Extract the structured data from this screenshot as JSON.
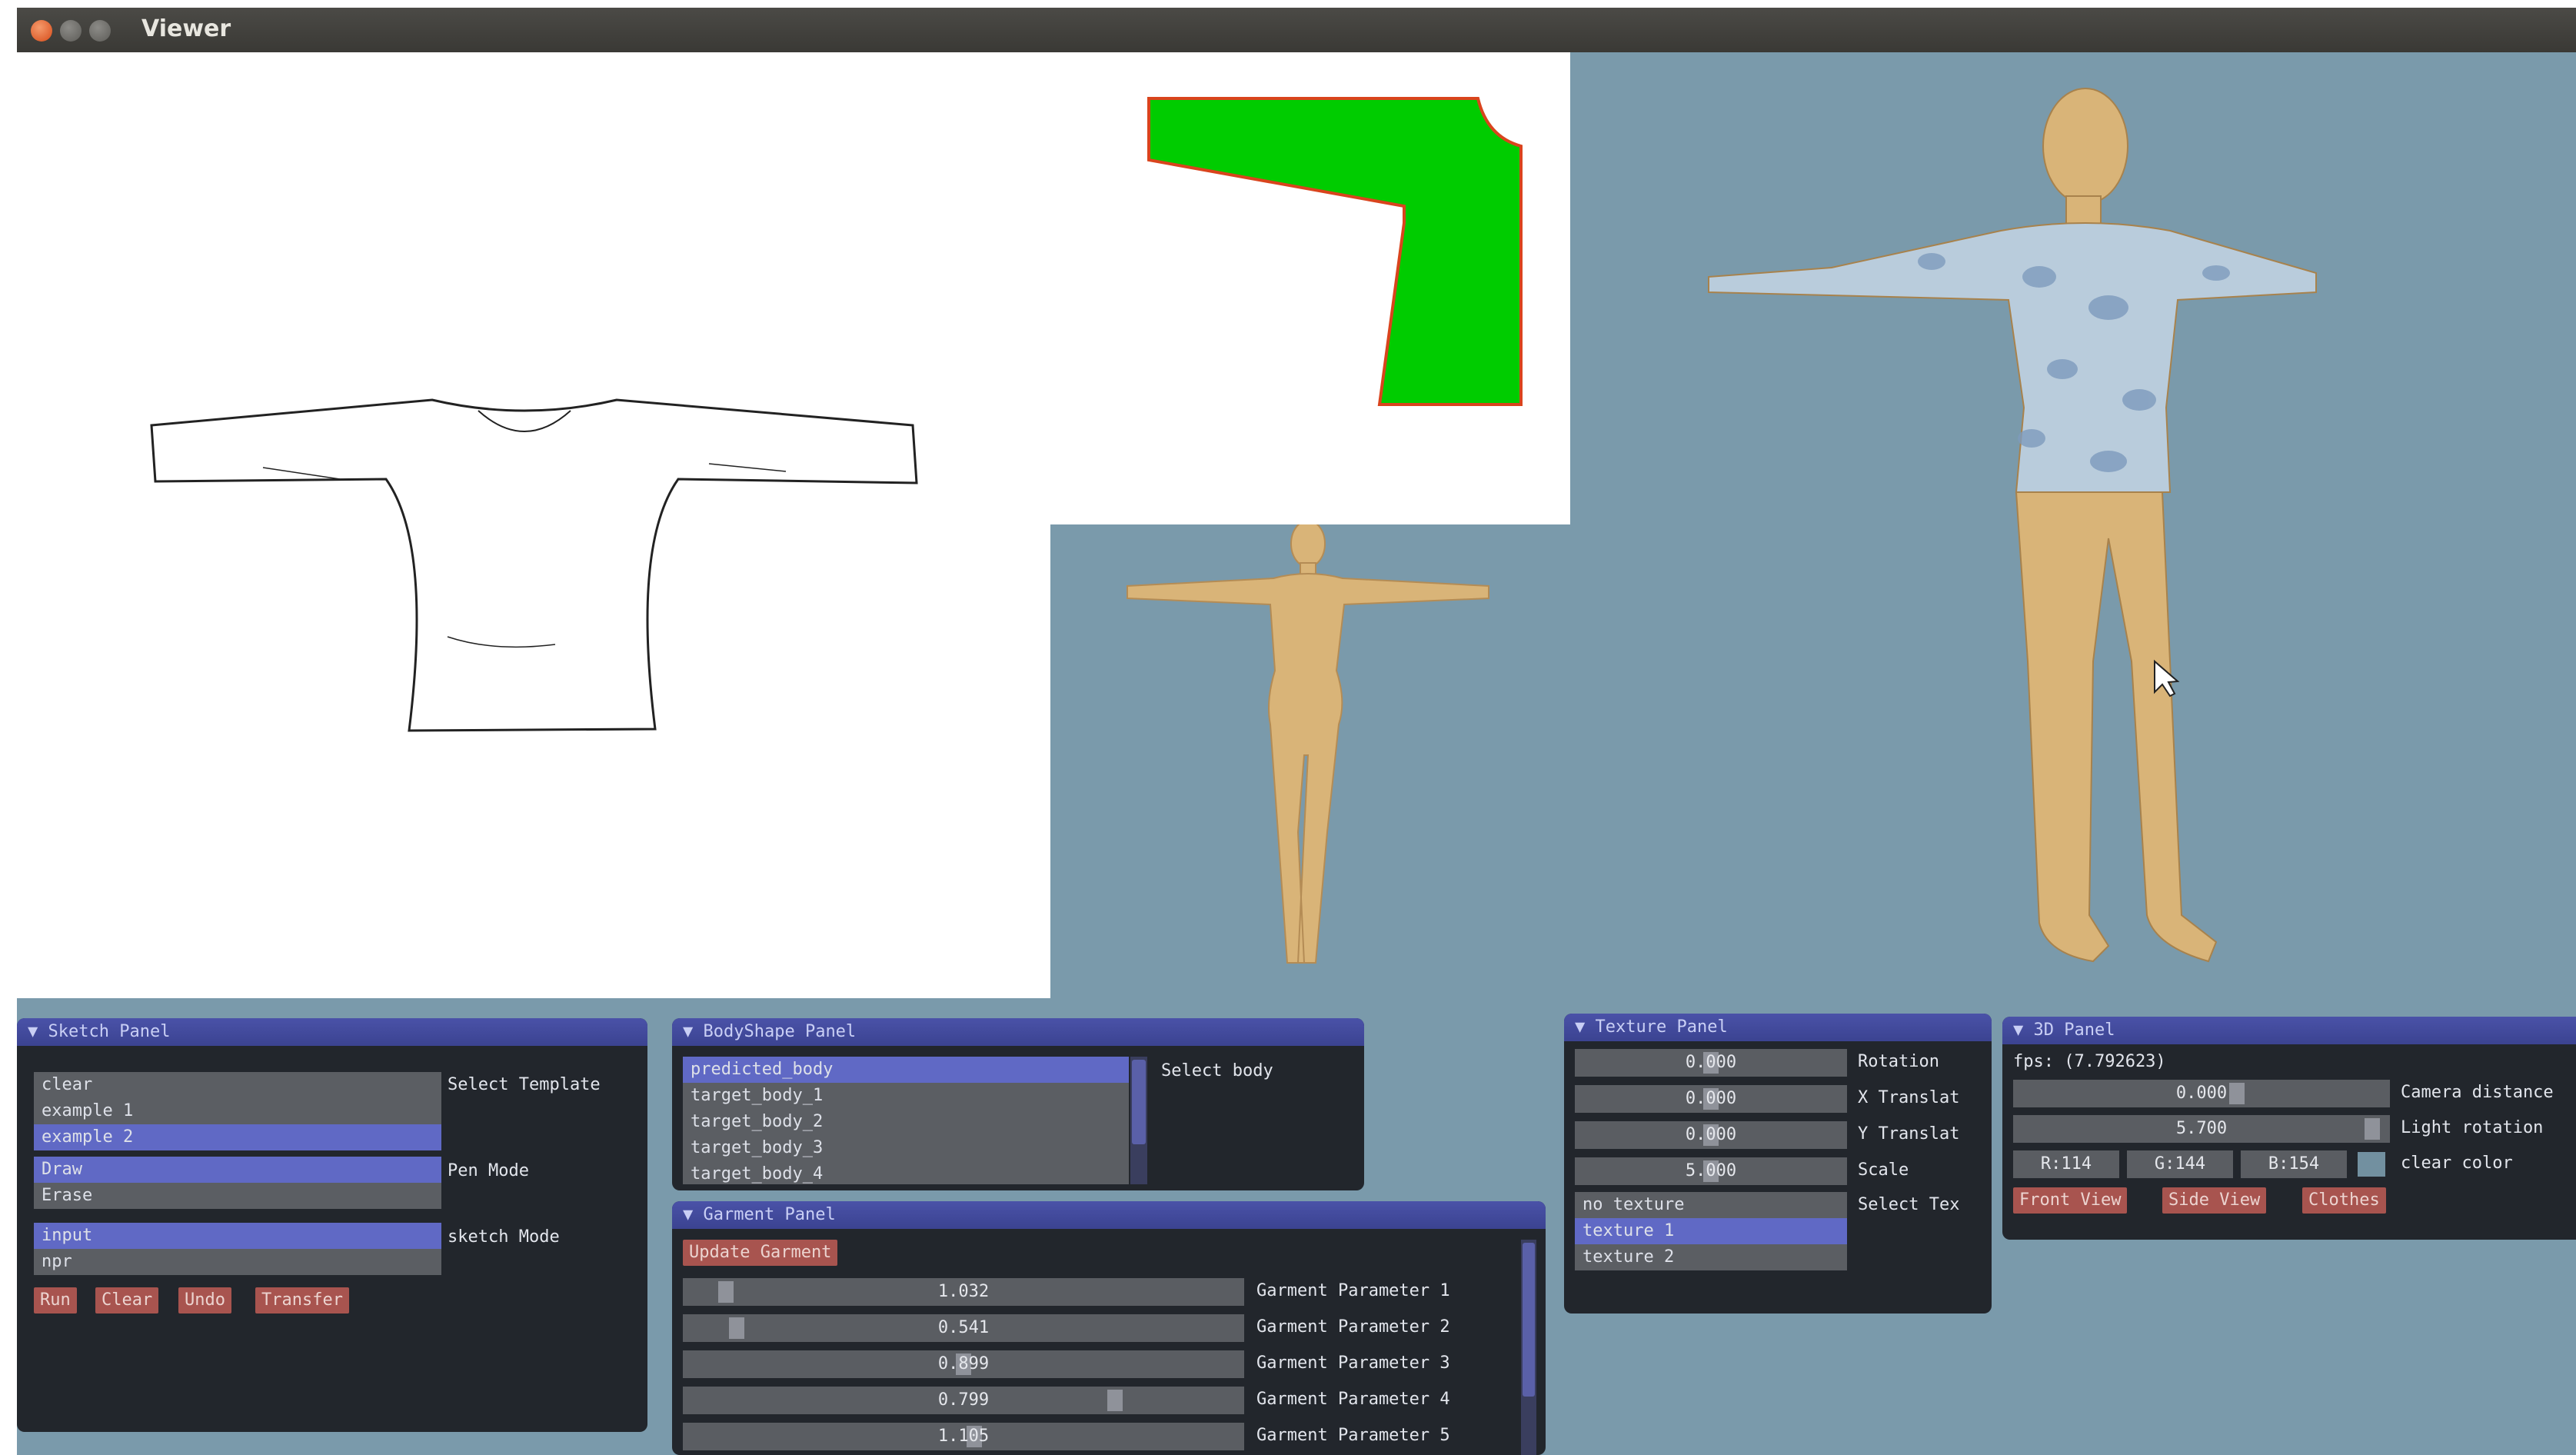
{
  "window": {
    "title": "Viewer"
  },
  "sketch_panel": {
    "title": "Sketch Panel",
    "templates": [
      "clear",
      "example 1",
      "example 2"
    ],
    "templates_selected": 2,
    "template_label": "Select Template",
    "pen_modes": [
      "Draw",
      "Erase"
    ],
    "pen_modes_selected": 0,
    "pen_label": "Pen Mode",
    "sketch_modes": [
      "input",
      "npr"
    ],
    "sketch_modes_selected": 0,
    "sketch_label": "sketch Mode",
    "buttons": {
      "run": "Run",
      "clear": "Clear",
      "undo": "Undo",
      "transfer": "Transfer"
    }
  },
  "bodyshape_panel": {
    "title": "BodyShape Panel",
    "bodies": [
      "predicted_body",
      "target_body_1",
      "target_body_2",
      "target_body_3",
      "target_body_4"
    ],
    "selected": 0,
    "label": "Select body"
  },
  "garment_panel": {
    "title": "Garment Panel",
    "update_button": "Update Garment",
    "params": [
      {
        "value": "1.032",
        "label": "Garment Parameter 1",
        "level": 0.06
      },
      {
        "value": "0.541",
        "label": "Garment Parameter 2",
        "level": 0.08
      },
      {
        "value": "0.899",
        "label": "Garment Parameter 3",
        "level": 0.5
      },
      {
        "value": "0.799",
        "label": "Garment Parameter 4",
        "level": 0.78
      },
      {
        "value": "1.105",
        "label": "Garment Parameter 5",
        "level": 0.52
      }
    ]
  },
  "texture_panel": {
    "title": "Texture Panel",
    "sliders": [
      {
        "value": "0.000",
        "label": "Rotation",
        "level": 0.5
      },
      {
        "value": "0.000",
        "label": "X Translat",
        "level": 0.5
      },
      {
        "value": "0.000",
        "label": "Y Translat",
        "level": 0.5
      },
      {
        "value": "5.000",
        "label": "Scale",
        "level": 0.5
      }
    ],
    "textures": [
      "no texture",
      "texture 1",
      "texture 2"
    ],
    "textures_selected": 1,
    "select_label": "Select Tex"
  },
  "panel_3d": {
    "title": "3D Panel",
    "fps": "fps: (7.792623)",
    "camera": {
      "value": "0.000",
      "label": "Camera distance",
      "level": 0.6
    },
    "light": {
      "value": "5.700",
      "label": "Light rotation",
      "level": 0.98
    },
    "color": {
      "r": "R:114",
      "g": "G:144",
      "b": "B:154",
      "label": "clear color",
      "swatch": "#7290a0"
    },
    "buttons": {
      "front": "Front View",
      "side": "Side View",
      "clothes": "Clothes"
    }
  },
  "colors": {
    "viewport_bg": "#7a9aab",
    "pattern_fill": "#00cc00",
    "pattern_edge": "#d9441d",
    "skin": "#d9b478",
    "panel_header": "#3b4391",
    "selected_item": "#6069c5",
    "button": "#a8544f"
  }
}
